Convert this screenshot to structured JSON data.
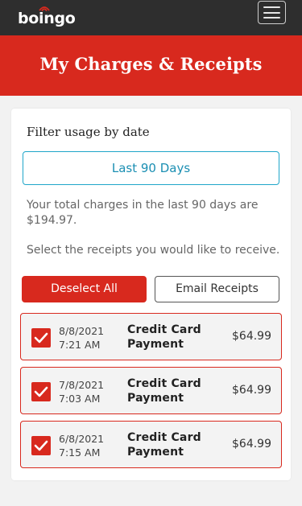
{
  "header": {
    "logo_text": "boingo",
    "menu_icon": "hamburger-menu-icon"
  },
  "banner": {
    "title": "My Charges & Receipts"
  },
  "filter": {
    "title": "Filter usage by date",
    "selected_range": "Last 90 Days"
  },
  "summary": {
    "total_text": "Your total charges in the last 90 days are $194.97.",
    "select_text": "Select the receipts you would like to receive."
  },
  "actions": {
    "deselect_label": "Deselect All",
    "email_label": "Email Receipts"
  },
  "receipts": [
    {
      "date": "8/8/2021",
      "time": "7:21 AM",
      "type_line1": "Credit Card",
      "type_line2": "Payment",
      "amount": "$64.99",
      "checked": true
    },
    {
      "date": "7/8/2021",
      "time": "7:03 AM",
      "type_line1": "Credit Card",
      "type_line2": "Payment",
      "amount": "$64.99",
      "checked": true
    },
    {
      "date": "6/8/2021",
      "time": "7:15 AM",
      "type_line1": "Credit Card",
      "type_line2": "Payment",
      "amount": "$64.99",
      "checked": true
    }
  ],
  "colors": {
    "brand_red": "#d8291e",
    "accent_blue": "#1fa6c9",
    "topbar": "#2e2e2e"
  }
}
